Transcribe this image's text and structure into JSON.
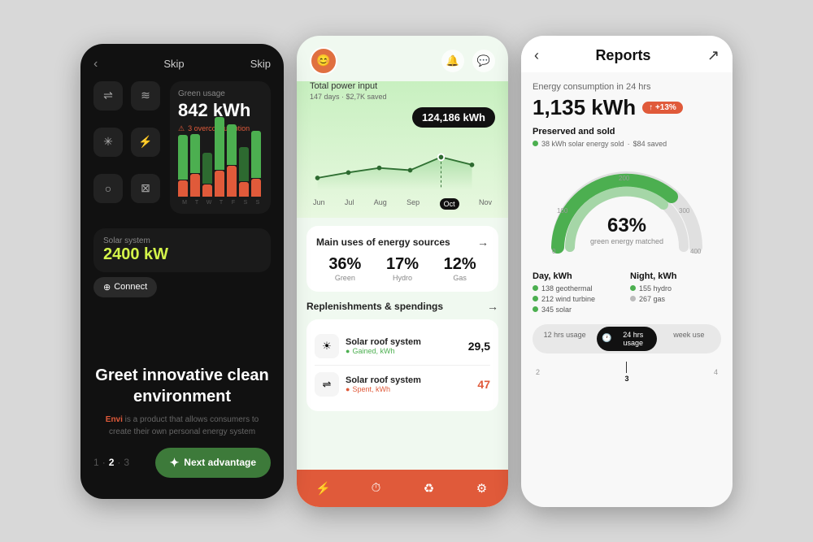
{
  "screen1": {
    "back_label": "‹",
    "skip_label": "Skip",
    "green_usage_label": "Green usage",
    "green_usage_value": "842 kWh",
    "overconsumption_text": "3 overconsumption",
    "solar_label": "Solar system",
    "solar_value": "2400 kW",
    "connect_label": "Connect",
    "headline": "Greet innovative clean environment",
    "subtext_prefix": " is a product that allows consumers to create their own personal energy system",
    "brand": "Envi",
    "pagination": "1 · 2 · 3",
    "page_1": "1",
    "separator": "·",
    "page_2": "2",
    "page_3": "3",
    "next_label": "Next advantage",
    "bars": [
      {
        "green": 55,
        "red": 20
      },
      {
        "green": 65,
        "red": 30
      },
      {
        "green": 40,
        "red": 15
      },
      {
        "green": 70,
        "red": 35
      },
      {
        "green": 50,
        "red": 40
      },
      {
        "green": 45,
        "red": 20
      },
      {
        "green": 60,
        "red": 25
      }
    ],
    "day_labels": [
      "M",
      "T",
      "W",
      "T",
      "F",
      "S",
      "S"
    ]
  },
  "screen2": {
    "total_power_label": "Total power input",
    "total_sub": "147 days · $2,7K saved",
    "kwh_badge": "124,186 kWh",
    "months": [
      "Jun",
      "Jul",
      "Aug",
      "Sep",
      "Oct",
      "Nov"
    ],
    "active_month": "Oct",
    "main_uses_title": "Main uses of energy sources",
    "energy_sources": [
      {
        "pct": "36%",
        "type": "Green"
      },
      {
        "pct": "17%",
        "type": "Hydro"
      },
      {
        "pct": "12%",
        "type": "Gas"
      }
    ],
    "replenishments_title": "Replenishments & spendings",
    "replenishments": [
      {
        "name": "Solar roof system",
        "sub": "Gained, kWh",
        "sub_color": "green",
        "value": "29,5",
        "value_color": "black"
      },
      {
        "name": "Solar roof system",
        "sub": "Spent, kWh",
        "sub_color": "red",
        "value": "47",
        "value_color": "red"
      }
    ],
    "nav_icons": [
      "⚡",
      "⏱",
      "♻",
      "⚙"
    ]
  },
  "screen3": {
    "title": "Reports",
    "back_label": "‹",
    "share_icon": "↗",
    "energy_cons_label": "Energy consumption in 24 hrs",
    "energy_cons_value": "1,135 kWh",
    "badge_label": "↑ +13%",
    "preserved_label": "Preserved and sold",
    "preserved_sub1": "38 kWh solar energy sold",
    "preserved_sub2": "$84 saved",
    "gauge_pct": "63%",
    "gauge_label": "green energy matched",
    "gauge_scale": [
      "0",
      "100",
      "200",
      "300",
      "400"
    ],
    "day_label": "Day, kWh",
    "night_label": "Night, kWh",
    "day_metrics": [
      {
        "dot": "green",
        "label": "138 geothermal"
      },
      {
        "dot": "green",
        "label": "212 wind turbine"
      },
      {
        "dot": "green",
        "label": "345 solar"
      }
    ],
    "night_metrics": [
      {
        "dot": "green",
        "label": "155 hydro"
      },
      {
        "dot": "gray",
        "label": "267 gas"
      }
    ],
    "time_tabs": [
      "12 hrs usage",
      "24 hrs usage",
      "week usage"
    ],
    "active_tab": "24 hrs usage",
    "timeline_markers": [
      "2",
      "3",
      "4"
    ]
  }
}
